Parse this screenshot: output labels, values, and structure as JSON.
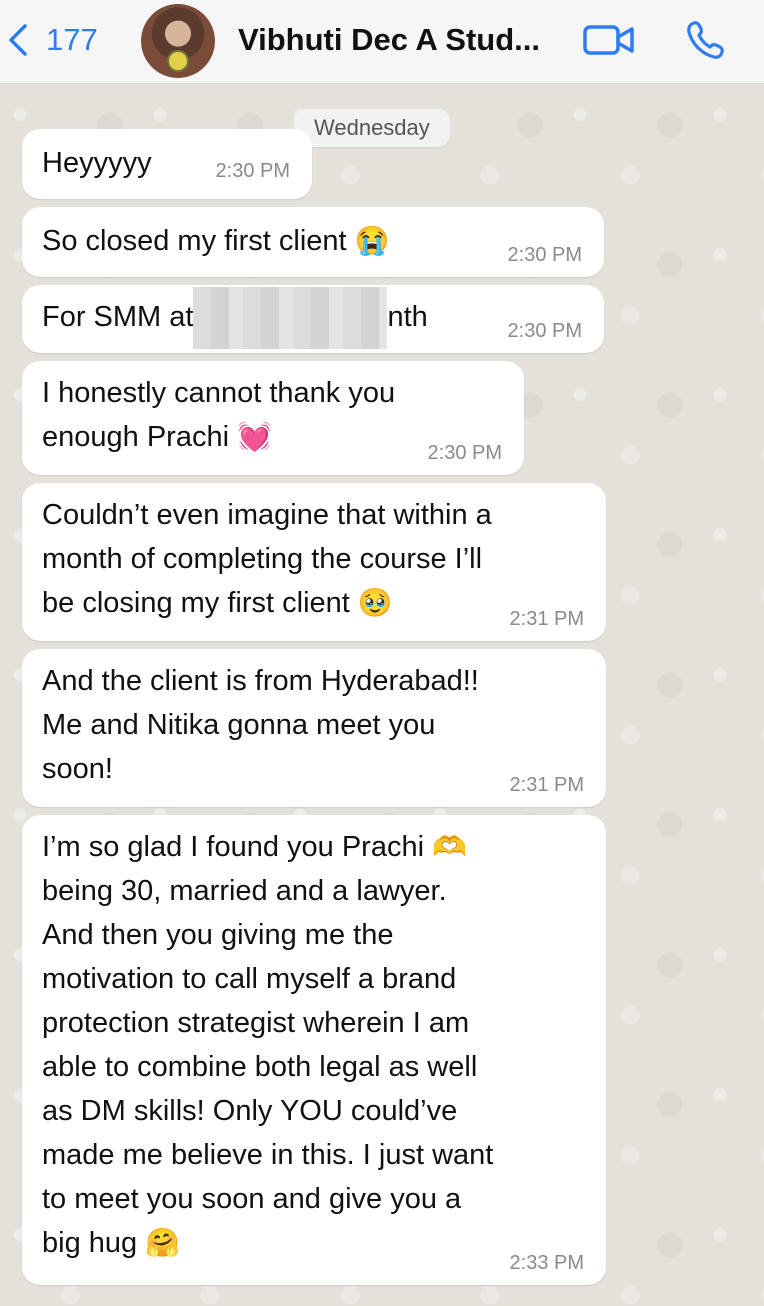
{
  "header": {
    "back_count": "177",
    "contact_name": "Vibhuti Dec A Stud..."
  },
  "chat": {
    "date_label": "Wednesday",
    "messages": [
      {
        "text": "Heyyyyy",
        "time": "2:30 PM"
      },
      {
        "text": "So closed my first client",
        "emoji": "😭",
        "time": "2:30 PM"
      },
      {
        "text_before": "For SMM at",
        "text_after": "nth",
        "time": "2:30 PM"
      },
      {
        "text": "I honestly cannot thank you\nenough Prachi",
        "emoji": "💓",
        "time": "2:30 PM"
      },
      {
        "text": "Couldn’t even imagine that within a\nmonth of completing the course I’ll\nbe closing my first client",
        "emoji": "🥹",
        "time": "2:31 PM"
      },
      {
        "text": "And the client is from Hyderabad!!\nMe and Nitika gonna meet you\nsoon!",
        "time": "2:31 PM"
      },
      {
        "text_line1": "I’m so glad I found you Prachi",
        "emoji_line1": "🫶",
        "text": "being 30, married and a lawyer.\nAnd then you giving me the\nmotivation to call myself a brand\nprotection strategist wherein I am\nable to combine both legal as well\nas DM skills! Only YOU could’ve\nmade me believe in this. I just want\nto meet you soon and give you a\nbig hug",
        "emoji": "🤗",
        "time": "2:33 PM"
      }
    ]
  },
  "colors": {
    "accent": "#2d7cf6",
    "bubble": "#ffffff",
    "chat_background": "#e4e0da",
    "header_background": "#f6f6f6"
  },
  "icons": [
    "chevron-left-icon",
    "video-call-icon",
    "phone-call-icon"
  ]
}
